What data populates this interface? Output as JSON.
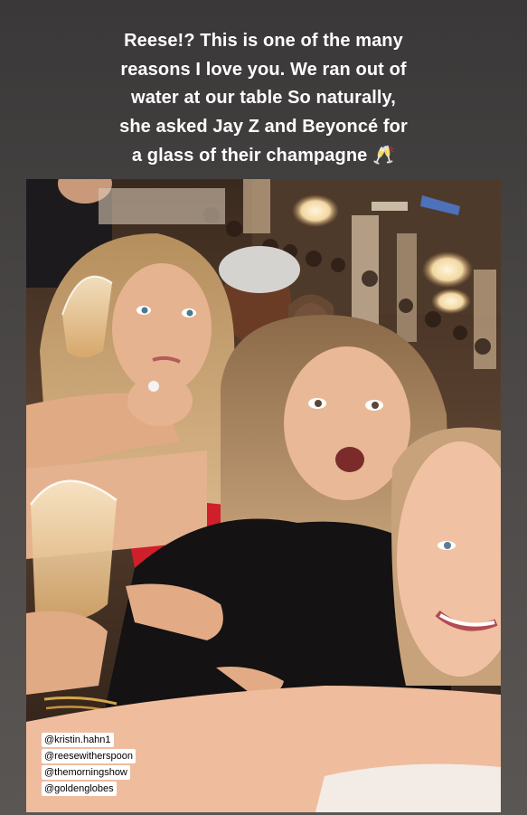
{
  "caption": {
    "line1": "Reese!? This is one of the many",
    "line2": "reasons I love you. We ran out of",
    "line3": "water at our table So naturally,",
    "line4": "she asked Jay Z and Beyoncé for",
    "line5": "a glass of their champagne",
    "emoji": "🥂"
  },
  "photo": {
    "description_icon": "selfie-photo"
  },
  "mentions": [
    "@kristin.hahn1",
    "@reesewitherspoon",
    "@themorningshow",
    "@goldenglobes"
  ],
  "colors": {
    "background": "#454241",
    "caption_text": "#ffffff",
    "tag_bg": "#ffffff",
    "tag_text": "#000000"
  }
}
